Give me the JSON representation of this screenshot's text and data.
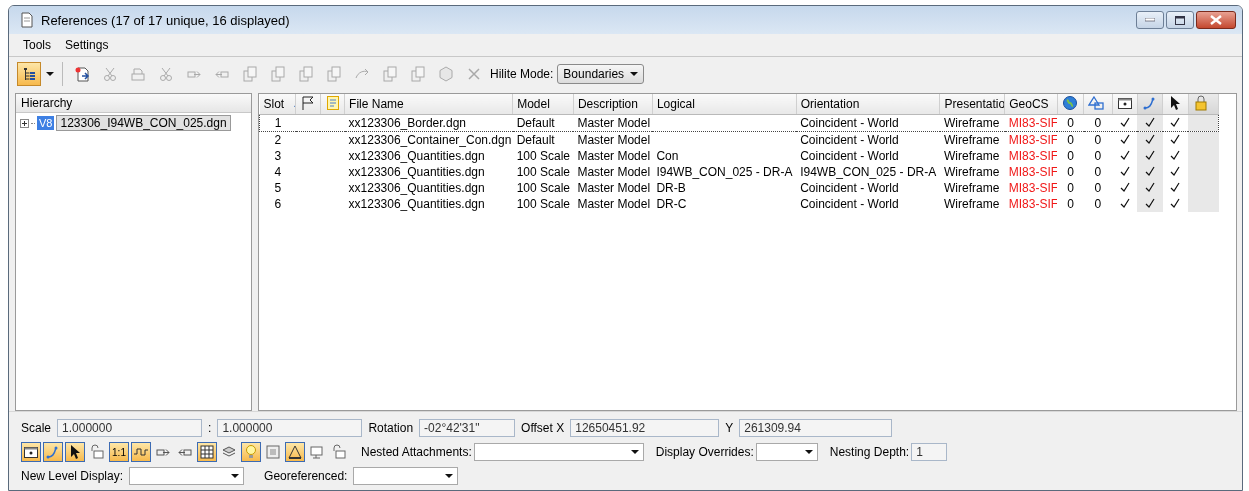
{
  "window": {
    "title": "References (17 of 17 unique, 16 displayed)"
  },
  "menu": [
    {
      "label": "Tools"
    },
    {
      "label": "Settings"
    }
  ],
  "toolbar": {
    "tools": [
      {
        "on": true,
        "disabled": false
      },
      {
        "on": false,
        "disabled": false
      },
      {
        "on": false,
        "disabled": true
      },
      {
        "on": false,
        "disabled": true
      },
      {
        "on": false,
        "disabled": true
      },
      {
        "on": false,
        "disabled": true
      },
      {
        "on": false,
        "disabled": true
      },
      {
        "on": false,
        "disabled": true
      },
      {
        "on": false,
        "disabled": true
      },
      {
        "on": false,
        "disabled": true
      },
      {
        "on": false,
        "disabled": true
      },
      {
        "on": false,
        "disabled": true
      },
      {
        "on": false,
        "disabled": true
      },
      {
        "on": false,
        "disabled": true
      },
      {
        "on": false,
        "disabled": true
      },
      {
        "on": false,
        "disabled": true
      }
    ],
    "hilite_label": "Hilite Mode:",
    "hilite_value": "Boundaries"
  },
  "hierarchy": {
    "title": "Hierarchy",
    "items": [
      {
        "badge": "V8",
        "label": "123306_I94WB_CON_025.dgn",
        "expanded": false,
        "selected": true
      }
    ]
  },
  "table": {
    "columns": [
      {
        "kind": "text",
        "label": "Slot",
        "sorted": true
      },
      {
        "kind": "icon"
      },
      {
        "kind": "icon"
      },
      {
        "kind": "text",
        "label": "File Name"
      },
      {
        "kind": "text",
        "label": "Model"
      },
      {
        "kind": "text",
        "label": "Description"
      },
      {
        "kind": "text",
        "label": "Logical"
      },
      {
        "kind": "text",
        "label": "Orientation"
      },
      {
        "kind": "text",
        "label": "Presentatio"
      },
      {
        "kind": "warning",
        "label": "GeoCS"
      },
      {
        "kind": "icon"
      },
      {
        "kind": "icon"
      },
      {
        "kind": "icon"
      },
      {
        "kind": "icon",
        "shaded": true
      },
      {
        "kind": "icon"
      },
      {
        "kind": "icon",
        "shaded": true
      }
    ],
    "rows": [
      {
        "selected": true,
        "cells": [
          "1",
          null,
          null,
          "xx123306_Border.dgn",
          "Default",
          "Master Model",
          null,
          "Coincident - World",
          "Wireframe",
          "MI83-SIF",
          "0",
          "0",
          true,
          true,
          true,
          false
        ]
      },
      {
        "selected": false,
        "cells": [
          "2",
          null,
          null,
          "xx123306_Container_Con.dgn",
          "Default",
          "Master Model",
          null,
          "Coincident - World",
          "Wireframe",
          "MI83-SIF",
          "0",
          "0",
          true,
          true,
          true,
          false
        ]
      },
      {
        "selected": false,
        "cells": [
          "3",
          null,
          null,
          "xx123306_Quantities.dgn",
          "100 Scale",
          "Master Model",
          "Con",
          "Coincident - World",
          "Wireframe",
          "MI83-SIF",
          "0",
          "0",
          true,
          true,
          true,
          false
        ]
      },
      {
        "selected": false,
        "cells": [
          "4",
          null,
          null,
          "xx123306_Quantities.dgn",
          "100 Scale",
          "Master Model",
          "I94WB_CON_025 - DR-A",
          "I94WB_CON_025 - DR-A",
          "Wireframe",
          "MI83-SIF",
          "0",
          "0",
          true,
          true,
          true,
          false
        ]
      },
      {
        "selected": false,
        "cells": [
          "5",
          null,
          null,
          "xx123306_Quantities.dgn",
          "100 Scale",
          "Master Model",
          "DR-B",
          "Coincident - World",
          "Wireframe",
          "MI83-SIF",
          "0",
          "0",
          true,
          true,
          true,
          false
        ]
      },
      {
        "selected": false,
        "cells": [
          "6",
          null,
          null,
          "xx123306_Quantities.dgn",
          "100 Scale",
          "Master Model",
          "DR-C",
          "Coincident - World",
          "Wireframe",
          "MI83-SIF",
          "0",
          "0",
          true,
          true,
          true,
          false
        ]
      }
    ]
  },
  "settings": {
    "scale_label": "Scale",
    "scale_value": "1.000000",
    "ratio_separator": ":",
    "scale_value_2": "1.000000",
    "rotation_label": "Rotation",
    "rotation_value": "-02°42'31\"",
    "offset_x_label": "Offset X",
    "offset_x_value": "12650451.92",
    "y_label": "Y",
    "y_value": "261309.94",
    "toggles": [
      {
        "on": true
      },
      {
        "on": true
      },
      {
        "on": true
      },
      {
        "on": false
      },
      {
        "on": true,
        "label": "1:1"
      },
      {
        "on": true
      },
      {
        "on": false
      },
      {
        "on": false
      },
      {
        "on": true
      },
      {
        "on": false
      },
      {
        "on": true
      },
      {
        "on": false
      },
      {
        "on": true
      },
      {
        "on": false
      },
      {
        "on": false
      }
    ],
    "nested_label": "Nested Attachments:",
    "display_overrides_label": "Display Overrides:",
    "nesting_depth_label": "Nesting Depth:",
    "nesting_depth_value": "1",
    "new_level_label": "New Level Display:",
    "georeferenced_label": "Georeferenced:"
  }
}
